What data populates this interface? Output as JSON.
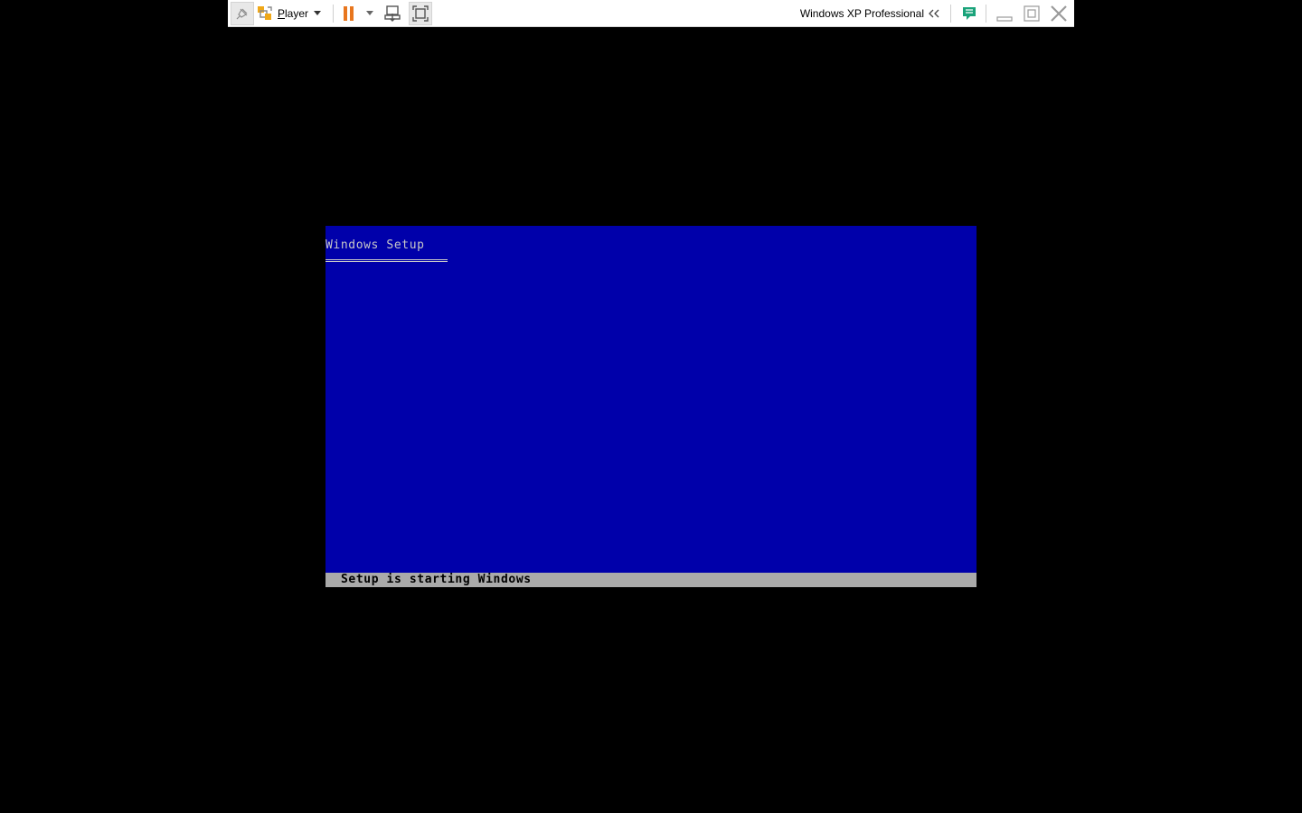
{
  "toolbar": {
    "player_menu_label": "Player",
    "vm_name": "Windows XP Professional",
    "icons": {
      "pin": "pin-icon",
      "player": "vmware-player-icon",
      "player_caret": "chevron-down-icon",
      "pause": "pause-icon",
      "pause_caret": "chevron-down-icon",
      "ctrl_alt_del": "send-ctrl-alt-del-icon",
      "unity": "fit-guest-icon",
      "collapse": "double-chevron-left-icon",
      "messages": "message-log-icon",
      "minimize": "minimize-icon",
      "restore": "restore-icon",
      "close": "close-icon"
    },
    "colors": {
      "pause_accent": "#e8761e",
      "player_logo_accent": "#f0a818",
      "messages_accent": "#1aa37a"
    }
  },
  "guest_screen": {
    "title": "Windows Setup",
    "status_text": "Setup is starting Windows",
    "colors": {
      "background": "#0000aa",
      "status_bar": "#aaaaaa",
      "title_text": "#c8c8c8"
    }
  }
}
